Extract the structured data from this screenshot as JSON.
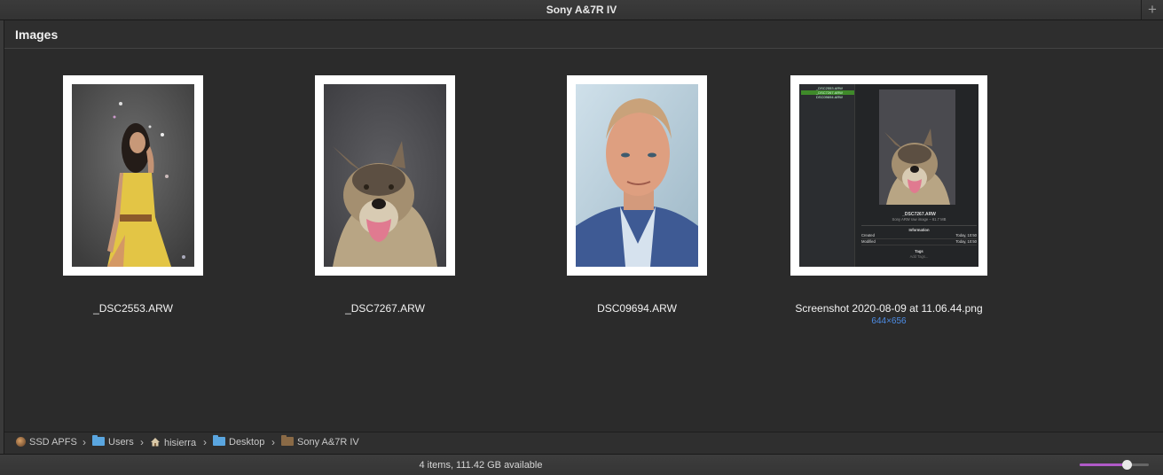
{
  "window": {
    "title": "Sony A&7R IV",
    "add_label": "+"
  },
  "section": {
    "title": "Images"
  },
  "items": [
    {
      "name": "_DSC2553.ARW",
      "dims": ""
    },
    {
      "name": "_DSC7267.ARW",
      "dims": ""
    },
    {
      "name": "DSC09694.ARW",
      "dims": ""
    },
    {
      "name": "Screenshot 2020-08-09 at 11.06.44.png",
      "dims": "644×656"
    }
  ],
  "screenshot_thumb": {
    "files": [
      "_DSC2553.ARW",
      "_DSC7267.ARW",
      "DSC09694.ARW"
    ],
    "filename": "_DSC7267.ARW",
    "subtitle": "Sony ARW raw image – 61.7 MB",
    "info_header": "Information",
    "created_label": "Created",
    "created_value": "Today, 10:50",
    "modified_label": "Modified",
    "modified_value": "Today, 10:50",
    "tags_header": "Tags",
    "tags_placeholder": "Add Tags..."
  },
  "path": [
    {
      "label": "SSD APFS",
      "icon": "disk-icon"
    },
    {
      "label": "Users",
      "icon": "folder-icon"
    },
    {
      "label": "hisierra",
      "icon": "home-icon"
    },
    {
      "label": "Desktop",
      "icon": "folder-icon"
    },
    {
      "label": "Sony A&7R IV",
      "icon": "folder-icon"
    }
  ],
  "path_separator": "›",
  "status": {
    "text": "4 items, 111.42 GB available"
  },
  "zoom": {
    "level": 0.68
  },
  "colors": {
    "accent": "#b05ac8",
    "dims": "#4d8de6",
    "folder_blue": "#5aa6e0",
    "folder_brown": "#8a6a46"
  }
}
